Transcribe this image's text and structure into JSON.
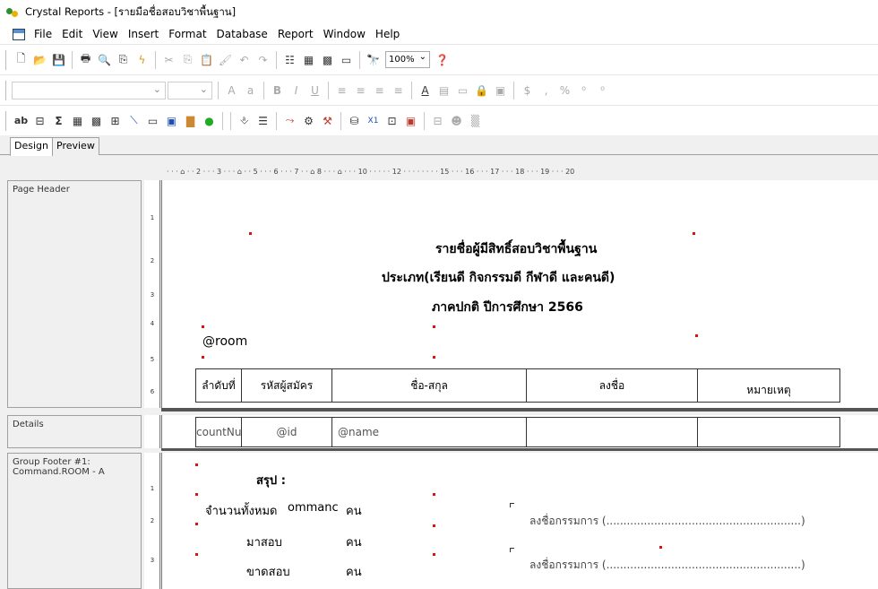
{
  "window": {
    "title": "Crystal Reports - [รายมือชื่อสอบวิชาพื้นฐาน]"
  },
  "menu": [
    "File",
    "Edit",
    "View",
    "Insert",
    "Format",
    "Database",
    "Report",
    "Window",
    "Help"
  ],
  "toolbar": {
    "zoom": "100%"
  },
  "tabs": {
    "design": "Design",
    "preview": "Preview"
  },
  "ruler": "· · · ⌂ · · 2 · · · 3 · · · ⌂ · · 5 · · · 6 · · · 7 · · ⌂ 8 · · · ⌂ · · · 10 · · · · · 12 · · · · · · · · 15 · · · 16 · · · 17 · · · 18 · · · 19 · · · 20",
  "sections": {
    "page_header": "Page Header",
    "details": "Details",
    "group_footer": "Group Footer #1:\nCommand.ROOM - A"
  },
  "report": {
    "title1": "รายชื่อผู้มีสิทธิ์สอบวิชาพื้นฐาน",
    "title2": "ประเภท(เรียนดี กิจกรรมดี กีฬาดี และคนดี)",
    "title3": "ภาคปกติ ปีการศึกษา 2566",
    "room_param": "@room",
    "headers": [
      "ลำดับที่",
      "รหัสผู้สมัคร",
      "ชื่อ-สกุล",
      "ลงชื่อ",
      "หมายเหตุ"
    ],
    "details_fields": [
      "countNu",
      "@id",
      "@name"
    ],
    "footer": {
      "summary": "สรุป :",
      "total_label": "จำนวนทั้งหมด",
      "total_field": "ommanc",
      "unit": "คน",
      "present_label": "มาสอบ",
      "absent_label": "ขาดสอบ",
      "sign1": "ลงชื่อกรรมการ (.........................................................)",
      "sign2": "ลงชื่อกรรมการ (.........................................................)"
    }
  },
  "vruler": [
    "1",
    "2",
    "3",
    "4",
    "5",
    "6",
    "1",
    "2",
    "3"
  ]
}
